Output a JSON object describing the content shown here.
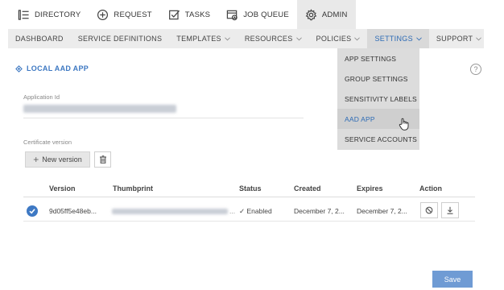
{
  "topnav": {
    "items": [
      {
        "label": "DIRECTORY",
        "icon": "directory-icon"
      },
      {
        "label": "REQUEST",
        "icon": "plus-circle-icon"
      },
      {
        "label": "TASKS",
        "icon": "checkbox-icon"
      },
      {
        "label": "JOB QUEUE",
        "icon": "job-queue-icon"
      },
      {
        "label": "ADMIN",
        "icon": "gear-icon",
        "active": true
      }
    ]
  },
  "subnav": {
    "items": [
      {
        "label": "DASHBOARD"
      },
      {
        "label": "SERVICE DEFINITIONS"
      },
      {
        "label": "TEMPLATES"
      },
      {
        "label": "RESOURCES"
      },
      {
        "label": "POLICIES"
      },
      {
        "label": "SETTINGS",
        "active": true
      },
      {
        "label": "SUPPORT"
      }
    ]
  },
  "settings_menu": {
    "options": [
      "APP SETTINGS",
      "GROUP SETTINGS",
      "SENSITIVITY LABELS",
      "AAD APP",
      "SERVICE ACCOUNTS"
    ],
    "hovered": "AAD APP"
  },
  "section": {
    "title": "LOCAL AAD APP",
    "help": "?"
  },
  "application": {
    "label": "Application Id"
  },
  "certificate": {
    "label": "Certificate version",
    "new_button": "New version",
    "columns": [
      "Version",
      "Thumbprint",
      "Status",
      "Created",
      "Expires",
      "Action"
    ],
    "rows": [
      {
        "version": "9d05ff5e48eb...",
        "status": "✓ Enabled",
        "created": "December 7, 2...",
        "expires": "December 7, 2..."
      }
    ]
  },
  "footer": {
    "save_label": "Save"
  },
  "colors": {
    "accent": "#3d78c2",
    "save_button": "#6f9bd4",
    "nav_active": "#e9e9e9"
  }
}
